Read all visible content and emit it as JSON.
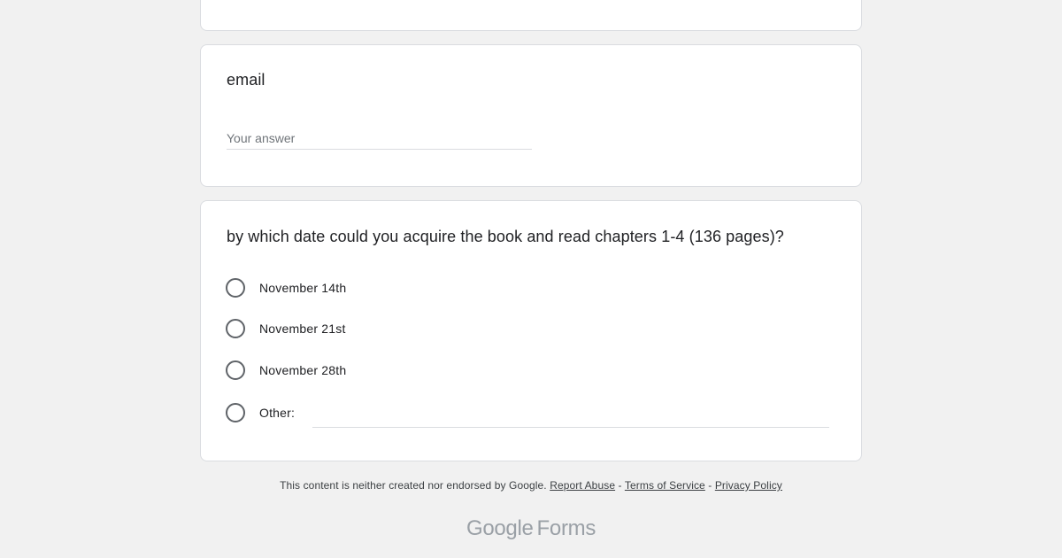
{
  "email_question": {
    "title": "email",
    "placeholder": "Your answer"
  },
  "date_question": {
    "title": "by which date could you acquire the book and read chapters 1-4 (136 pages)?",
    "options": [
      {
        "label": "November 14th"
      },
      {
        "label": "November 21st"
      },
      {
        "label": "November 28th"
      },
      {
        "label": "Other:"
      }
    ]
  },
  "footer": {
    "disclaimer": "This content is neither created nor endorsed by Google.",
    "separator": "-",
    "report_abuse": "Report Abuse",
    "terms": "Terms of Service",
    "privacy": "Privacy Policy"
  },
  "brand": {
    "google": "Google",
    "forms": "Forms"
  },
  "colors": {
    "background": "#f1f1f1",
    "card": "#ffffff",
    "radio_border": "#5f6368",
    "brand_text": "#9aa0a6"
  }
}
